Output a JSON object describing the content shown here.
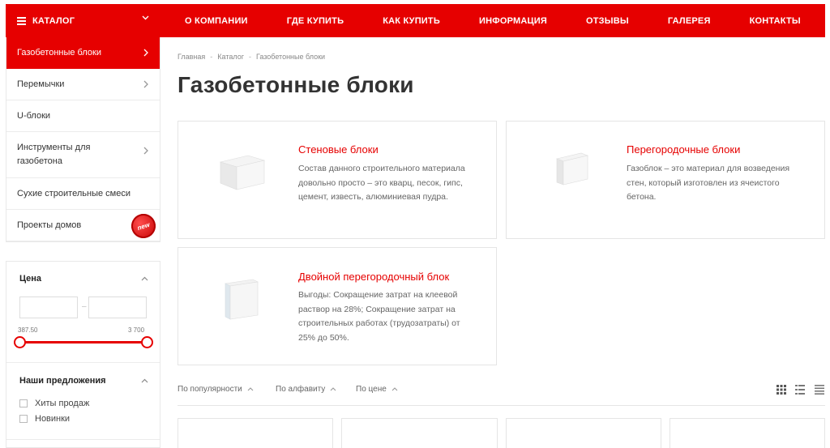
{
  "nav": {
    "catalog_label": "КАТАЛОГ",
    "items": [
      "О КОМПАНИИ",
      "ГДЕ КУПИТЬ",
      "КАК КУПИТЬ",
      "ИНФОРМАЦИЯ",
      "ОТЗЫВЫ",
      "ГАЛЕРЕЯ",
      "КОНТАКТЫ"
    ]
  },
  "sidebar": {
    "items": [
      {
        "label": "Газобетонные блоки"
      },
      {
        "label": "Перемычки"
      },
      {
        "label": "U-блоки"
      },
      {
        "label": "Инструменты для газобетона"
      },
      {
        "label": "Сухие строительные смеси"
      },
      {
        "label": "Проекты домов",
        "badge": "new"
      }
    ]
  },
  "filter": {
    "price_title": "Цена",
    "min_value": "387.50",
    "max_value": "3 700",
    "offers_title": "Наши предложения",
    "offers": [
      "Хиты продаж",
      "Новинки"
    ]
  },
  "breadcrumb": [
    "Главная",
    "Каталог",
    "Газобетонные блоки"
  ],
  "page_title": "Газобетонные блоки",
  "categories": [
    {
      "title": "Стеновые блоки",
      "desc": "Состав данного строительного материала довольно просто – это кварц, песок, гипс, цемент, известь, алюминиевая пудра."
    },
    {
      "title": "Перегородочные блоки",
      "desc": "Газоблок – это материал для возведения стен, который изготовлен из ячеистого бетона."
    },
    {
      "title": "Двойной перегородочный блок",
      "desc": "Выгоды: Сокращение затрат на клеевой раствор на 28%; Сокращение затрат на строительных работах (трудозатраты) от 25% до 50%."
    }
  ],
  "sort": [
    "По популярности",
    "По алфавиту",
    "По цене"
  ],
  "colors": {
    "accent": "#e60000"
  }
}
